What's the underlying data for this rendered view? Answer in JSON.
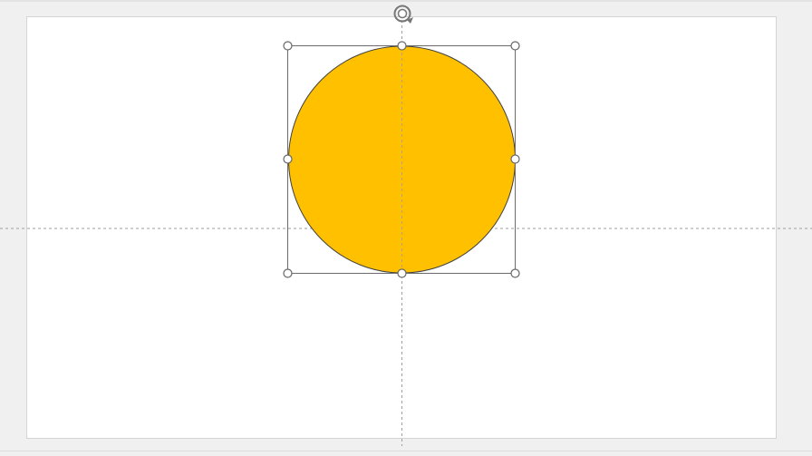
{
  "editor": {
    "canvas_background": "#f0f0f0",
    "slide_background": "#ffffff",
    "guides": [
      "horizontal-center-guide",
      "vertical-center-guide"
    ]
  },
  "selected_shape": {
    "shape_type": "oval",
    "fill_color": "#ffc000",
    "outline_color": "#404040",
    "selected": true,
    "handles": [
      "top-left",
      "top-center",
      "top-right",
      "middle-left",
      "middle-right",
      "bottom-left",
      "bottom-center",
      "bottom-right"
    ],
    "rotate_handle_icon": "rotate-icon"
  },
  "colors": {
    "guide_line": "#9e9e9e",
    "selection_box": "#6b6b6b",
    "handle_fill": "#ffffff",
    "handle_stroke": "#666666"
  }
}
